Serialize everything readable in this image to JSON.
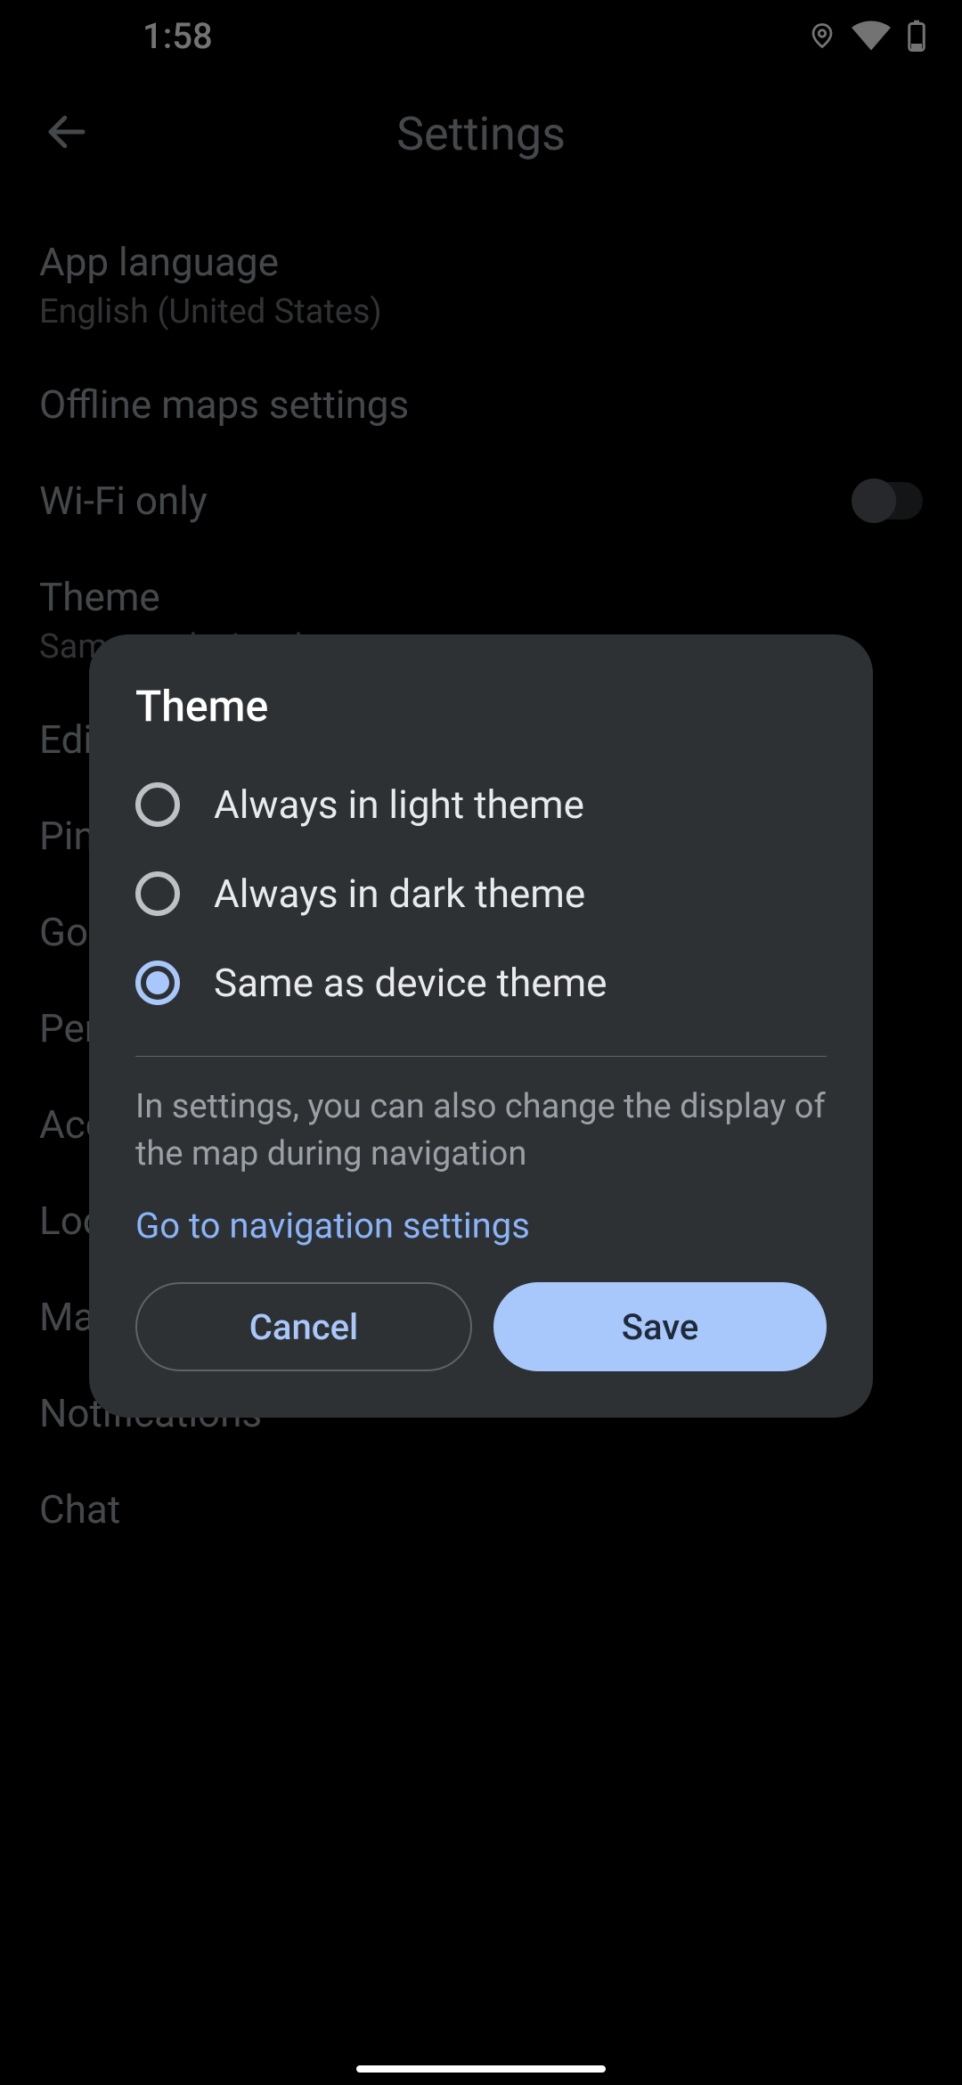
{
  "status": {
    "time": "1:58"
  },
  "app_bar": {
    "title": "Settings"
  },
  "settings": [
    {
      "title": "App language",
      "sub": "English (United States)"
    },
    {
      "title": "Offline maps settings",
      "sub": ""
    },
    {
      "title": "Wi-Fi only",
      "sub": "",
      "toggle": true
    },
    {
      "title": "Theme",
      "sub": "Same as device theme"
    },
    {
      "title": "Edit home or work",
      "sub": ""
    },
    {
      "title": "Pinned trips",
      "sub": ""
    },
    {
      "title": "Google location settings",
      "sub": ""
    },
    {
      "title": "Personal content",
      "sub": ""
    },
    {
      "title": "Accessibility settings",
      "sub": ""
    },
    {
      "title": "Location accuracy tips",
      "sub": ""
    },
    {
      "title": "Maps history",
      "sub": ""
    },
    {
      "title": "Notifications",
      "sub": ""
    },
    {
      "title": "Chat",
      "sub": ""
    }
  ],
  "dialog": {
    "title": "Theme",
    "options": [
      {
        "label": "Always in light theme",
        "selected": false
      },
      {
        "label": "Always in dark theme",
        "selected": false
      },
      {
        "label": "Same as device theme",
        "selected": true
      }
    ],
    "note": "In settings, you can also change the display of the map during navigation",
    "link": "Go to navigation settings",
    "cancel": "Cancel",
    "save": "Save"
  }
}
